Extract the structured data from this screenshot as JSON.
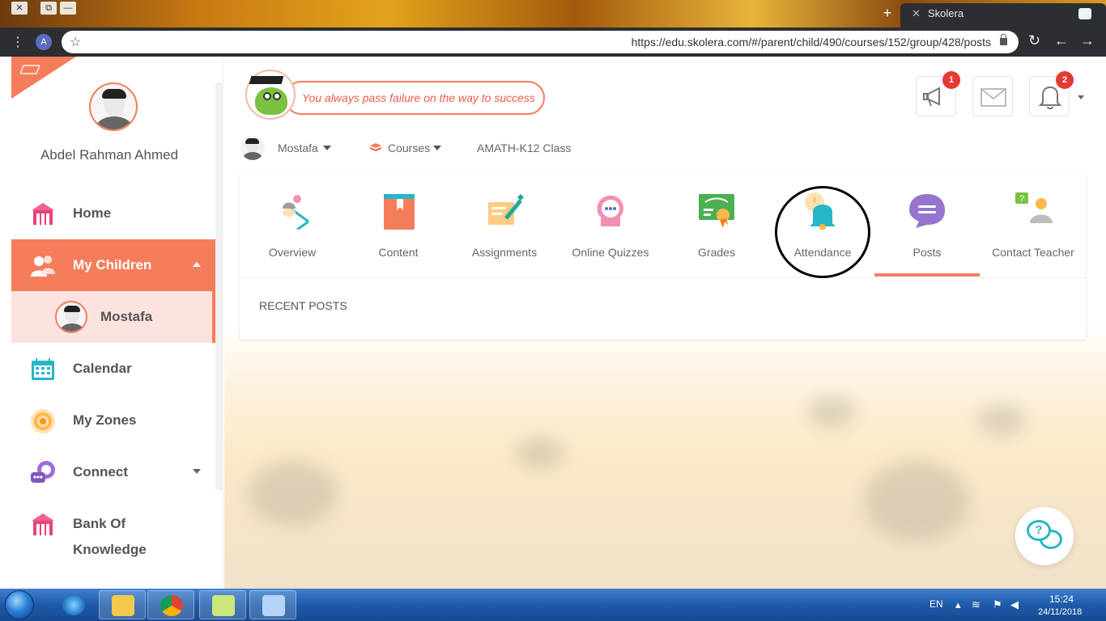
{
  "browser": {
    "tab_title": "Skolera",
    "tab_close": "✕",
    "new_tab": "+",
    "profile_initial": "A",
    "url": "https://edu.skolera.com/#/parent/child/490/courses/152/group/428/posts",
    "window_buttons": [
      "✕",
      "⧉",
      "—"
    ]
  },
  "sidebar": {
    "profile_name": "Abdel Rahman Ahmed",
    "items": [
      {
        "label": "Home",
        "icon": "school-building-icon"
      },
      {
        "label": "My Children",
        "icon": "children-icon",
        "active": true,
        "expanded": true
      },
      {
        "label": "Calendar",
        "icon": "calendar-icon"
      },
      {
        "label": "My Zones",
        "icon": "zones-target-icon"
      },
      {
        "label": "Connect",
        "icon": "connect-chat-icon"
      },
      {
        "label": "Bank Of",
        "label2": "Knowledge",
        "icon": "bank-building-icon"
      }
    ],
    "child": {
      "label": "Mostafa"
    }
  },
  "header": {
    "quote": "You always pass failure on the way to success",
    "announcements_badge": "1",
    "notifications_badge": "2"
  },
  "breadcrumb": {
    "child": "Mostafa",
    "courses": "Courses",
    "class": "AMATH-K12 Class"
  },
  "course_tabs": [
    {
      "label": "Overview",
      "icon": "overview-lamp-icon"
    },
    {
      "label": "Content",
      "icon": "content-book-icon"
    },
    {
      "label": "Assignments",
      "icon": "assignments-pen-icon"
    },
    {
      "label": "Online Quizzes",
      "icon": "quizzes-head-icon"
    },
    {
      "label": "Grades",
      "icon": "grades-certificate-icon"
    },
    {
      "label": "Attendance",
      "icon": "attendance-bell-icon"
    },
    {
      "label": "Posts",
      "icon": "posts-chat-icon",
      "active": true
    },
    {
      "label": "Contact Teacher",
      "icon": "contact-teacher-icon"
    }
  ],
  "posts": {
    "heading": "RECENT POSTS"
  },
  "taskbar": {
    "language": "EN",
    "time": "15:24",
    "date": "24/11/2018"
  },
  "colors": {
    "accent": "#f57d5b",
    "sidebar_sub_bg": "#fde3df",
    "teal": "#26b7c6",
    "badge": "#e53935"
  }
}
